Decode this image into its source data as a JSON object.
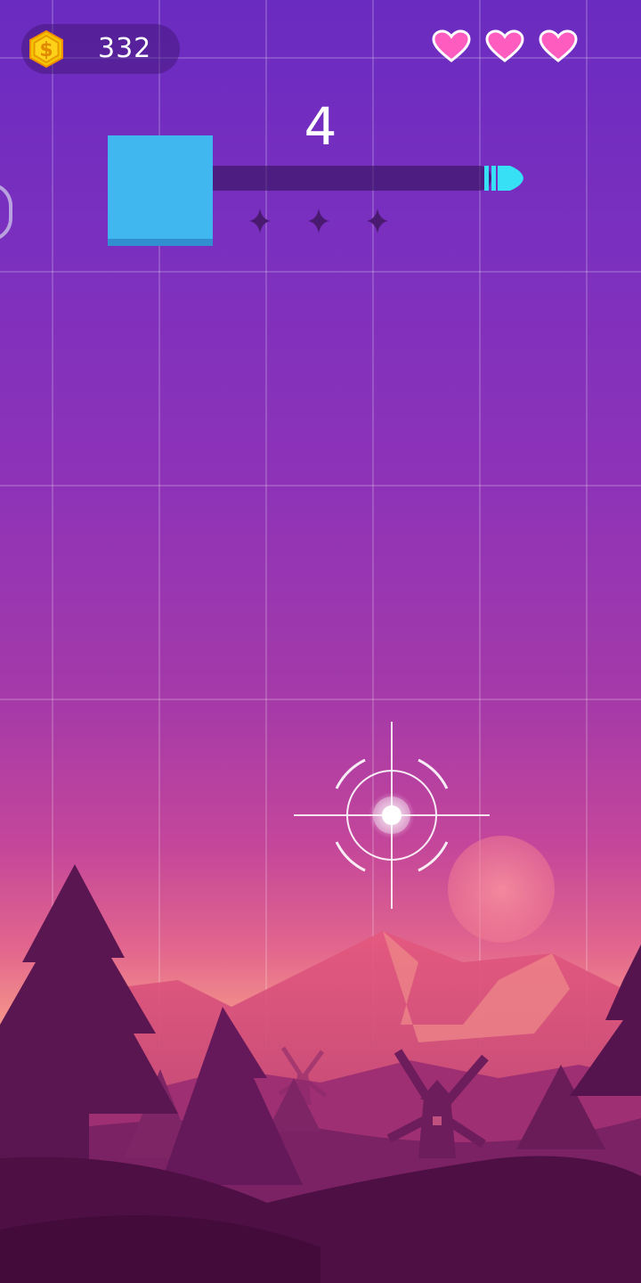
{
  "hud": {
    "coins": "332",
    "lives": 3,
    "coin_icon": "dollar-hexagon-icon",
    "heart_icon": "heart-icon"
  },
  "level": {
    "score": "4",
    "progress": 0.02,
    "stars_total": 3,
    "stars_earned": 0
  },
  "colors": {
    "accent_cyan": "#38e0f5",
    "heart_pink": "#ff5cc0",
    "tile_blue": "#40b8ef",
    "coin_gold": "#f5c400"
  }
}
